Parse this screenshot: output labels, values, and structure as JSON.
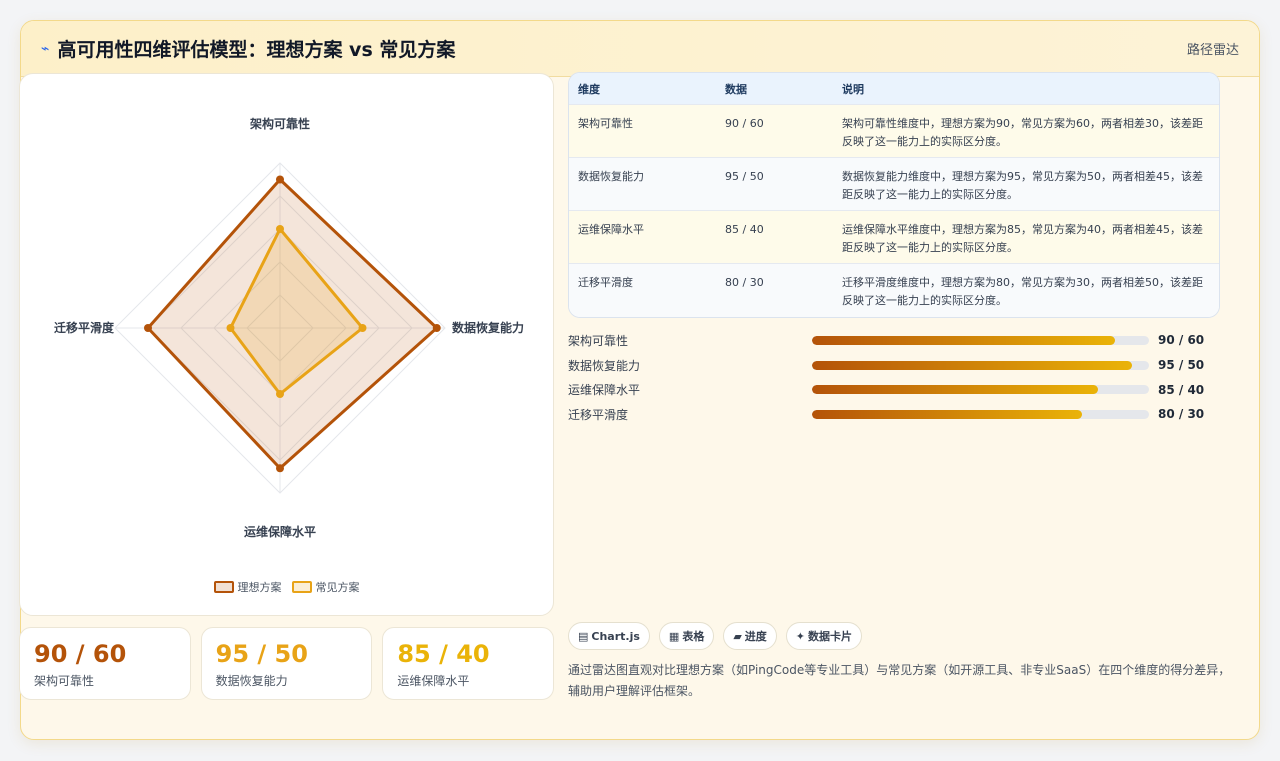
{
  "header": {
    "icon": "⌁",
    "title": "高可用性四维评估模型：理想方案 vs 常见方案",
    "right_label": "路径雷达"
  },
  "colors": {
    "ideal": "#b45309",
    "common": "#e8a317",
    "stat": [
      "#b45309",
      "#e8a317",
      "#eab308"
    ]
  },
  "chart_data": {
    "type": "radar",
    "axes": [
      "架构可靠性",
      "数据恢复能力",
      "运维保障水平",
      "迁移平滑度"
    ],
    "series": [
      {
        "name": "理想方案",
        "values": [
          90,
          95,
          85,
          80
        ]
      },
      {
        "name": "常见方案",
        "values": [
          60,
          50,
          40,
          30
        ]
      }
    ],
    "max": 100,
    "legend_position": "bottom"
  },
  "stats": [
    {
      "value": "90 / 60",
      "label": "架构可靠性"
    },
    {
      "value": "95 / 50",
      "label": "数据恢复能力"
    },
    {
      "value": "85 / 40",
      "label": "运维保障水平"
    }
  ],
  "table": {
    "headers": [
      "维度",
      "数据",
      "说明"
    ],
    "rows": [
      {
        "dim": "架构可靠性",
        "data": "90 / 60",
        "desc": "架构可靠性维度中，理想方案为90，常见方案为60，两者相差30，该差距反映了这一能力上的实际区分度。"
      },
      {
        "dim": "数据恢复能力",
        "data": "95 / 50",
        "desc": "数据恢复能力维度中，理想方案为95，常见方案为50，两者相差45，该差距反映了这一能力上的实际区分度。"
      },
      {
        "dim": "运维保障水平",
        "data": "85 / 40",
        "desc": "运维保障水平维度中，理想方案为85，常见方案为40，两者相差45，该差距反映了这一能力上的实际区分度。"
      },
      {
        "dim": "迁移平滑度",
        "data": "80 / 30",
        "desc": "迁移平滑度维度中，理想方案为80，常见方案为30，两者相差50，该差距反映了这一能力上的实际区分度。"
      }
    ]
  },
  "progress": [
    {
      "label": "架构可靠性",
      "value": "90 / 60",
      "percent": 90
    },
    {
      "label": "数据恢复能力",
      "value": "95 / 50",
      "percent": 95
    },
    {
      "label": "运维保障水平",
      "value": "85 / 40",
      "percent": 85
    },
    {
      "label": "迁移平滑度",
      "value": "80 / 30",
      "percent": 80
    }
  ],
  "tags": [
    {
      "icon": "▤",
      "label": "Chart.js"
    },
    {
      "icon": "▦",
      "label": "表格"
    },
    {
      "icon": "▰",
      "label": "进度"
    },
    {
      "icon": "✦",
      "label": "数据卡片"
    }
  ],
  "description": "通过雷达图直观对比理想方案（如PingCode等专业工具）与常见方案（如开源工具、非专业SaaS）在四个维度的得分差异，辅助用户理解评估框架。"
}
